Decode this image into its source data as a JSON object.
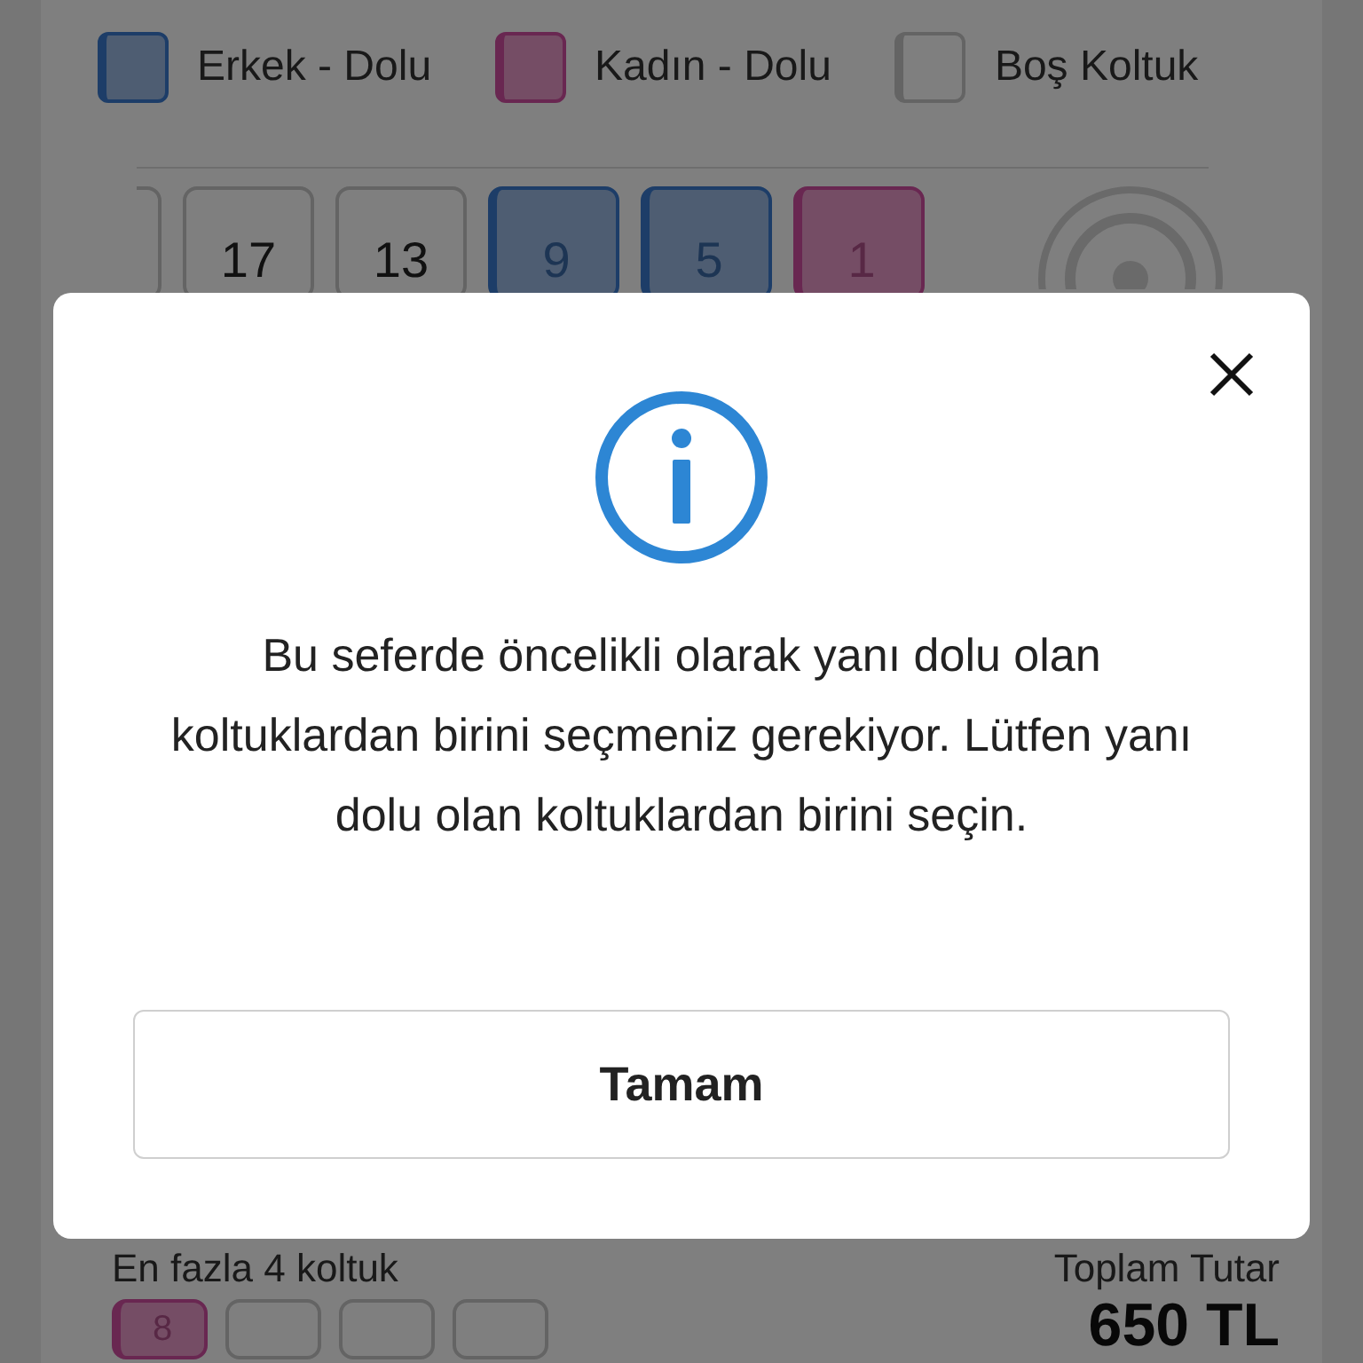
{
  "legend": [
    {
      "label": "Erkek - Dolu",
      "kind": "male"
    },
    {
      "label": "Kadın - Dolu",
      "kind": "female"
    },
    {
      "label": "Boş Koltuk",
      "kind": "empty"
    }
  ],
  "seats": [
    {
      "kind": "empty"
    },
    {
      "kind": "empty",
      "number": "17"
    },
    {
      "kind": "empty",
      "number": "13"
    },
    {
      "kind": "male",
      "number": "9"
    },
    {
      "kind": "male",
      "number": "5"
    },
    {
      "kind": "female",
      "number": "1"
    }
  ],
  "selection": {
    "limit_label": "En fazla 4 koltuk",
    "seats": [
      {
        "kind": "female",
        "number": "8"
      },
      {
        "kind": "empty"
      },
      {
        "kind": "empty"
      },
      {
        "kind": "empty"
      }
    ]
  },
  "total": {
    "label": "Toplam Tutar",
    "amount": "650 TL"
  },
  "dialog": {
    "message": "Bu seferde öncelikli olarak yanı dolu olan koltuklardan birini seçmeniz gerekiyor. Lütfen yanı dolu olan koltuklardan birini seçin.",
    "button": "Tamam"
  }
}
